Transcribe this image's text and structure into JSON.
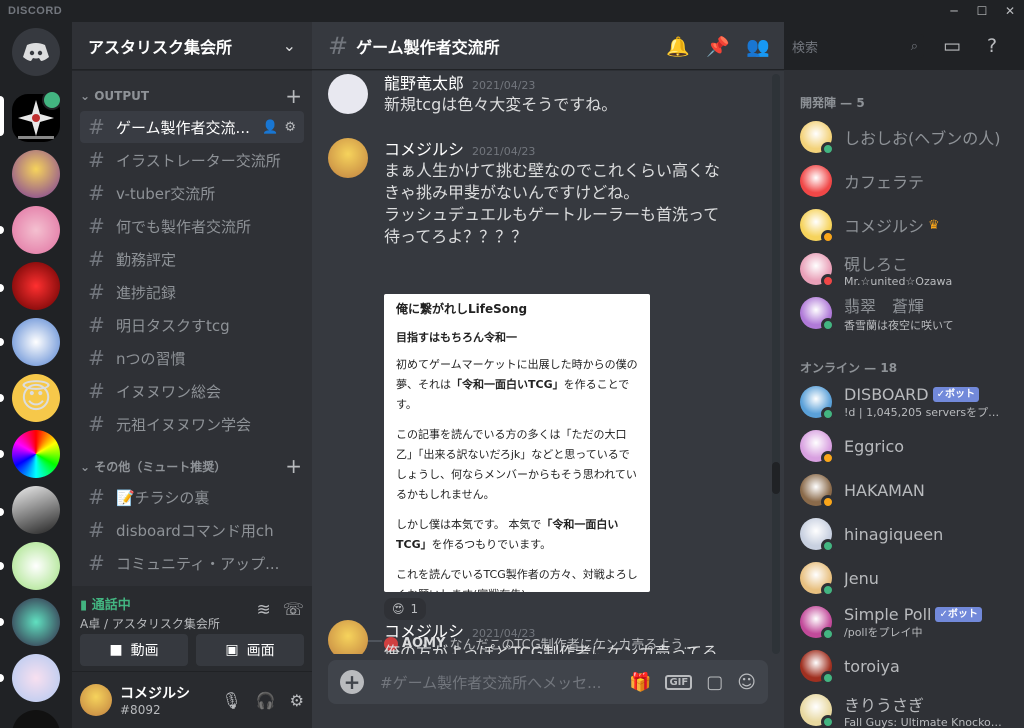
{
  "window": {
    "brand": "DISCORD",
    "minimize": "─",
    "maximize": "☐",
    "close": "✕"
  },
  "colors": {
    "online": "#43b581",
    "idle": "#faa61a",
    "dnd": "#f04747",
    "blurple": "#7289da"
  },
  "guild": {
    "name": "アスタリスク集会所"
  },
  "categories": [
    {
      "name": "OUTPUT",
      "add": "+"
    },
    {
      "name": "その他（ミュート推奨）",
      "add": "+"
    }
  ],
  "channels": [
    {
      "label": "ゲーム製作者交流...",
      "active": true
    },
    {
      "label": "イラストレーター交流所"
    },
    {
      "label": "v-tuber交流所"
    },
    {
      "label": "何でも製作者交流所"
    },
    {
      "label": "勤務評定"
    },
    {
      "label": "進捗記録"
    },
    {
      "label": "明日タスクすtcg"
    },
    {
      "label": "nつの習慣"
    },
    {
      "label": "イヌヌワン総会"
    },
    {
      "label": "元祖イヌヌワン学会"
    }
  ],
  "channels2": [
    {
      "label": "📝チラシの裏"
    },
    {
      "label": "disboardコマンド用ch"
    },
    {
      "label": "コミュニティ・アップ..."
    }
  ],
  "voice": {
    "status": "通話中",
    "location": "A卓 / アスタリスク集会所",
    "video": "動画",
    "screen": "画面"
  },
  "user": {
    "name": "コメジルシ",
    "tag": "#8092"
  },
  "channel": {
    "name": "ゲーム製作者交流所"
  },
  "search": {
    "placeholder": "検索"
  },
  "messages": [
    {
      "author": "龍野竜太郎",
      "time": "2021/04/23",
      "text": "新規tcgは色々大変そうですね。"
    },
    {
      "author": "コメジルシ",
      "time": "2021/04/23",
      "lines": [
        "まぁ人生かけて挑む壁なのでこれくらい高くな",
        "きゃ挑み甲斐がないんですけどね。",
        "ラッシュデュエルもゲートルーラーも首洗って",
        "待ってろよ？？？？"
      ]
    }
  ],
  "embed": {
    "title": "俺に繋がれしLifeSong",
    "subtitle": "目指すはもちろん令和一",
    "p1": "初めてゲームマーケットに出展した時からの僕の夢、それは",
    "p1b": "「令和一面白いTCG」",
    "p1c": "を作ることです。",
    "p2": "この記事を読んでいる方の多くは「ただの大口乙」「出来る訳ないだろjk」などと思っているでしょうし、何ならメンバーからもそう思われているかもしれません。",
    "p3a": "しかし僕は本気です。 本気で",
    "p3b": "「令和一面白いTCG」",
    "p3c": "を作るつもりでいます。",
    "p4": "これを読んでいるTCG製作者の方々、対戦よろしくお願いします(宣戦布告)"
  },
  "reaction": {
    "emoji": "😍",
    "count": "1"
  },
  "reply": {
    "author": "AOMY",
    "text": "なんだこのTCG制作者にケンカ売るよう..."
  },
  "last_message": {
    "author": "コメジルシ",
    "time": "2021/04/23",
    "text": "俺の方がよっぽどTCG制作者にケンカ売ってる"
  },
  "composer": {
    "placeholder": "#ゲーム製作者交流所へメッセ...",
    "gif": "GIF"
  },
  "member_groups": [
    {
      "title": "開発陣 — 5"
    },
    {
      "title": "オンライン — 18"
    }
  ],
  "members_dev": [
    {
      "name": "しおしお(ヘブンの人)",
      "status": "online",
      "av": "#f3d27a"
    },
    {
      "name": "カフェラテ",
      "status": "",
      "av": "#f04747"
    },
    {
      "name": "コメジルシ",
      "status": "idle",
      "av": "#f6d35c",
      "crown": "♛"
    },
    {
      "name": "硯しろこ",
      "status": "dnd",
      "av": "#e9a0b8",
      "activity": "Mr.☆united☆Ozawa"
    },
    {
      "name": "翡翠　蒼輝",
      "status": "online",
      "av": "#b07ad8",
      "activity": "香雪蘭は夜空に咲いて"
    }
  ],
  "members_online": [
    {
      "name": "DISBOARD",
      "status": "online",
      "av": "#5aa0d8",
      "bot": "✓ボット",
      "activity": "!d | 1,045,205 serversをプレ..."
    },
    {
      "name": "Eggrico",
      "status": "idle",
      "av": "#d8a0e0"
    },
    {
      "name": "HAKAMAN",
      "status": "idle",
      "av": "#8a6a4a"
    },
    {
      "name": "hinagiqueen",
      "status": "online",
      "av": "#c8d0e0"
    },
    {
      "name": "Jenu",
      "status": "online",
      "av": "#e8c080"
    },
    {
      "name": "Simple Poll",
      "status": "online",
      "av": "#c24a9a",
      "bot": "✓ボット",
      "activity": "/pollをプレイ中"
    },
    {
      "name": "toroiya",
      "status": "online",
      "av": "#a03020"
    },
    {
      "name": "きりうさぎ",
      "status": "online",
      "av": "#e8d8a0",
      "activity": "Fall Guys: Ultimate Knockout..."
    }
  ]
}
